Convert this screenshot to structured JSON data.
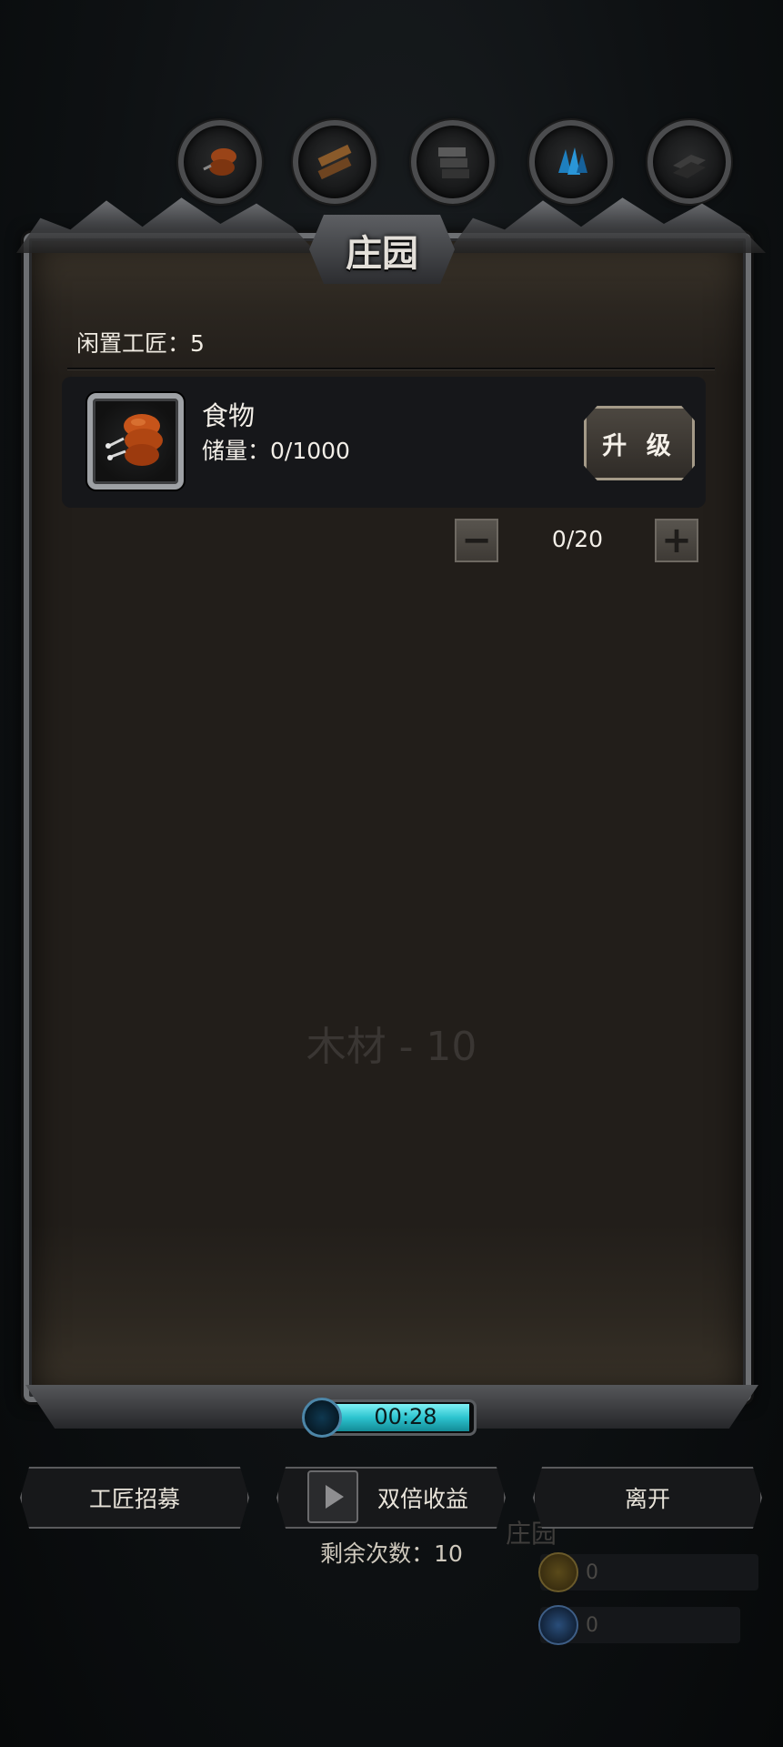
{
  "title": "庄园",
  "resource_tabs": [
    {
      "icon": "meat-icon",
      "color": "#a04a18"
    },
    {
      "icon": "wood-icon",
      "color": "#8a5a2a"
    },
    {
      "icon": "stone-icon",
      "color": "#555555"
    },
    {
      "icon": "crystal-icon",
      "color": "#1e7fbf"
    },
    {
      "icon": "iron-icon",
      "color": "#3c3c3c"
    }
  ],
  "idle_craftsmen": "闲置工匠：5",
  "item": {
    "name": "食物",
    "storage": "储量：0/1000",
    "upgrade_label": "升 级",
    "count": "0/20"
  },
  "watermark": "木材 - 10",
  "timer": "00:28",
  "actions": {
    "recruit": "工匠招募",
    "double": "双倍收益",
    "leave": "离开"
  },
  "remaining": "剩余次数：10",
  "background": {
    "label": "庄园",
    "gold_value": "0",
    "gem_value": "0"
  },
  "colors": {
    "accent_cyan": "#2cc3cf",
    "panel_bg": "#221e1a",
    "frame_metal": "#6d6f72"
  }
}
